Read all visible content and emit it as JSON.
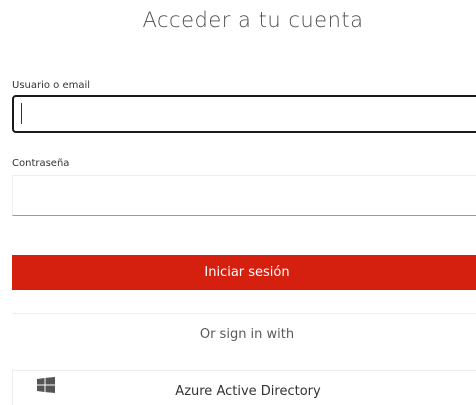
{
  "title": "Acceder a tu cuenta",
  "form": {
    "username_label": "Usuario o email",
    "username_value": "",
    "password_label": "Contraseña",
    "password_value": "",
    "submit_label": "Iniciar sesión"
  },
  "alt_login": {
    "heading": "Or sign in with",
    "providers": [
      {
        "label": "Azure Active Directory",
        "icon": "windows-icon"
      }
    ]
  },
  "colors": {
    "primary_button": "#d6200f",
    "focus_border": "#1a1a1a"
  }
}
